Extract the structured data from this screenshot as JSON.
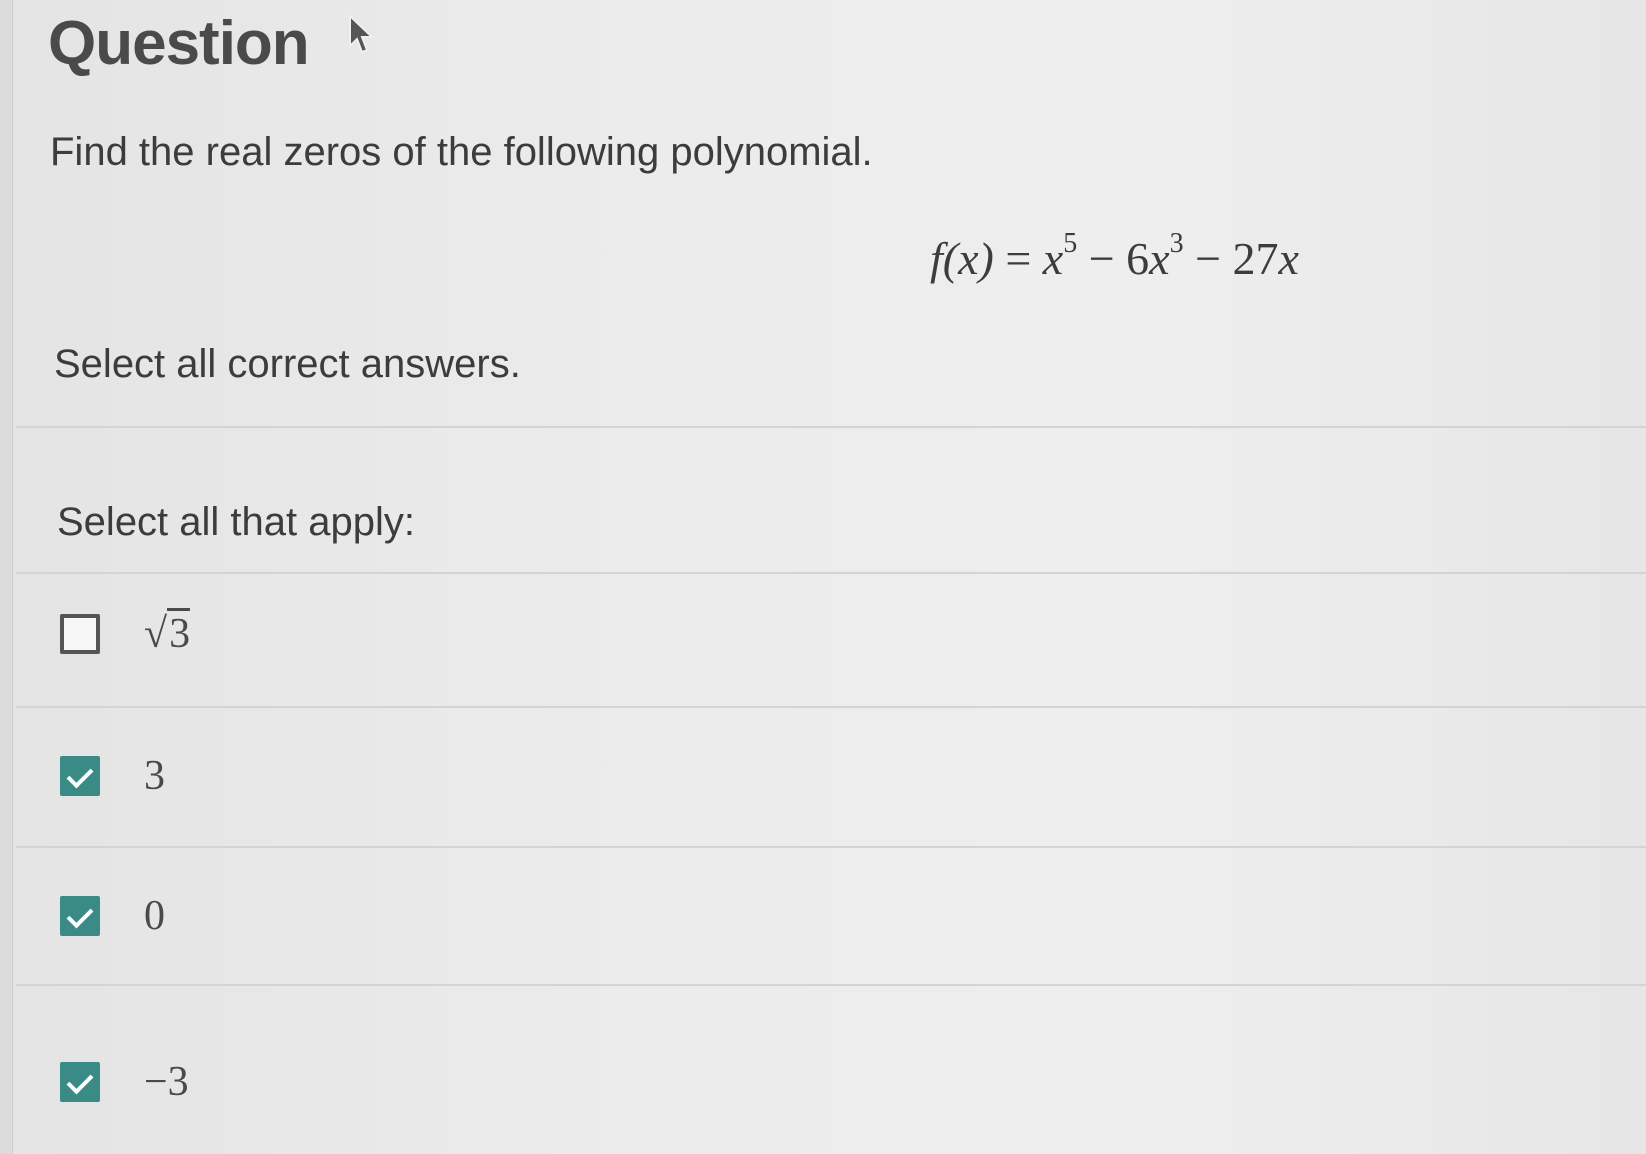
{
  "header": {
    "title": "Question"
  },
  "question": {
    "prompt": "Find the real zeros of the following polynomial.",
    "equation": {
      "lhs": "f(x)",
      "eq": "=",
      "t1_base": "x",
      "t1_exp": "5",
      "op1": "−",
      "t2_coef": "6",
      "t2_base": "x",
      "t2_exp": "3",
      "op2": "−",
      "t3_coef": "27",
      "t3_base": "x"
    },
    "instruction": "Select all correct answers."
  },
  "answers": {
    "label": "Select all that apply:",
    "options": [
      {
        "radical": "√",
        "value": "3",
        "checked": false
      },
      {
        "value": "3",
        "checked": true
      },
      {
        "value": "0",
        "checked": true
      },
      {
        "value": "−3",
        "checked": true
      }
    ]
  },
  "colors": {
    "accent": "#3a8a86",
    "text": "#3c3c3c"
  }
}
